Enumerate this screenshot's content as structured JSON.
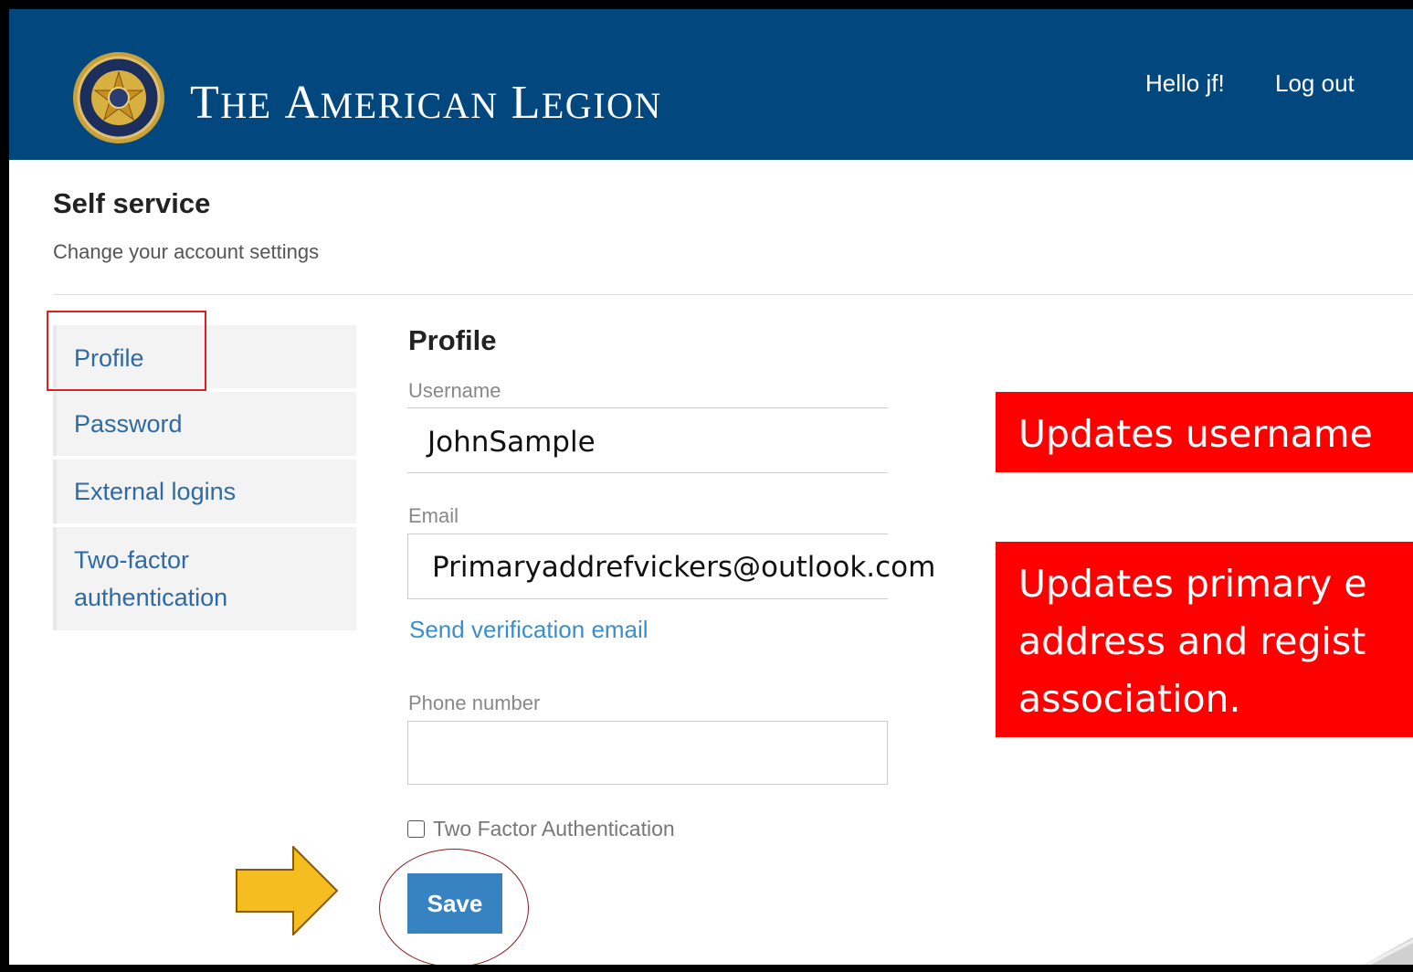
{
  "header": {
    "brand": "The American Legion",
    "brand_parts": {
      "t": "T",
      "he": "HE",
      "a": "A",
      "merican": "MERICAN",
      "l": "L",
      "egion": "EGION"
    },
    "greeting": "Hello jf!",
    "logout_label": "Log out",
    "background_color": "#03477f",
    "emblem_icon": "american-legion-emblem-icon"
  },
  "page": {
    "title": "Self service",
    "subtitle": "Change your account settings"
  },
  "sidebar": {
    "items": [
      {
        "label": "Profile",
        "active": true
      },
      {
        "label": "Password"
      },
      {
        "label": "External logins"
      },
      {
        "label": "Two-factor",
        "label_line2": "authentication"
      }
    ]
  },
  "profile": {
    "title": "Profile",
    "username_label": "Username",
    "username_value": "JohnSample",
    "email_label": "Email",
    "email_value": "Primaryaddrefvickers@outlook.com",
    "send_verification_label": "Send verification email",
    "phone_label": "Phone number",
    "phone_value": "",
    "two_factor_label": "Two Factor Authentication",
    "two_factor_checked": false,
    "save_label": "Save"
  },
  "annotations": {
    "callout_username": "Updates username",
    "callout_email_line1": "Updates primary e",
    "callout_email_line2": "address and regist",
    "callout_email_line3": "association.",
    "callout_color": "#ff0000",
    "arrow_color": "#f5bd1f",
    "arrow_icon": "right-arrow-icon"
  }
}
